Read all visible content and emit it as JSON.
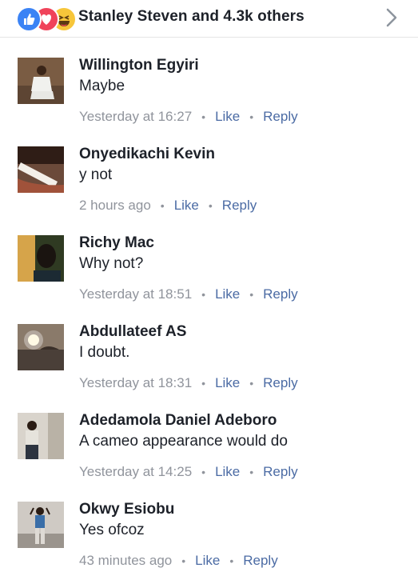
{
  "header": {
    "reactions_text": "Stanley Steven and 4.3k others",
    "reaction_icons": [
      "like-icon",
      "love-icon",
      "haha-icon"
    ],
    "colors": {
      "like": "#3b83f5",
      "love": "#f0435a",
      "haha": "#f7c63a"
    }
  },
  "comments": [
    {
      "name": "Willington Egyiri",
      "text": "Maybe",
      "time": "Yesterday at 16:27",
      "like": "Like",
      "reply": "Reply"
    },
    {
      "name": "Onyedikachi Kevin",
      "text": "y not",
      "time": "2 hours ago",
      "like": "Like",
      "reply": "Reply"
    },
    {
      "name": "Richy Mac",
      "text": "Why not?",
      "time": "Yesterday at 18:51",
      "like": "Like",
      "reply": "Reply"
    },
    {
      "name": "Abdullateef AS",
      "text": "I doubt.",
      "time": "Yesterday at 18:31",
      "like": "Like",
      "reply": "Reply"
    },
    {
      "name": "Adedamola Daniel Adeboro",
      "text": "A cameo appearance would do",
      "time": "Yesterday at 14:25",
      "like": "Like",
      "reply": "Reply"
    },
    {
      "name": "Okwy Esiobu",
      "text": "Yes ofcoz",
      "time": "43 minutes ago",
      "like": "Like",
      "reply": "Reply"
    }
  ],
  "dot": "•"
}
